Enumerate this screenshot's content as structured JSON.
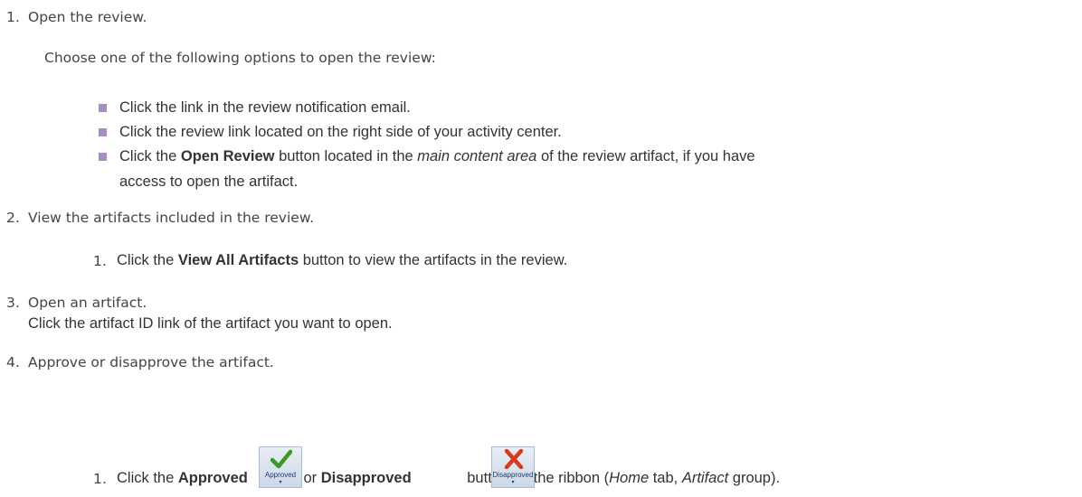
{
  "steps": [
    {
      "number": "1.",
      "title": "Open the review.",
      "intro": "Choose one of the following options to open the review:",
      "bullets": [
        {
          "text": "Click the link in the review notification email."
        },
        {
          "text": "Click the review link located on the right side of your activity center."
        },
        {
          "pre": "Click the ",
          "bold": "Open Review",
          "mid": " button located in the ",
          "italic": "main content area",
          "post": " of the review artifact, if you have",
          "line2": "access to open the artifact."
        }
      ]
    },
    {
      "number": "2.",
      "title": "View the artifacts included in the review.",
      "sub": {
        "number": "1.",
        "pre": "Click the ",
        "bold": "View All Artifacts",
        "post": " button to view the artifacts in the review."
      }
    },
    {
      "number": "3.",
      "title": "Open an artifact.",
      "line2": "Click the artifact ID link of the artifact you want to open."
    },
    {
      "number": "4.",
      "title": "Approve or disapprove the artifact.",
      "sub": {
        "number": "1.",
        "pre": "Click the ",
        "bold1": "Approved",
        "or": " or ",
        "bold2": "Disapproved",
        "post1": " button on the ribbon (",
        "italic1": "Home",
        "post2": " tab, ",
        "italic2": "Artifact",
        "post3": " group)."
      }
    }
  ],
  "ribbon": {
    "approved_label": "Approved",
    "disapproved_label": "Disapproved",
    "approved_icon": "check-icon",
    "disapproved_icon": "x-icon",
    "check_color": "#3a9a1f",
    "x_color": "#d93b1a"
  },
  "colors": {
    "bullet": "#a58fc1",
    "text": "#444444"
  }
}
